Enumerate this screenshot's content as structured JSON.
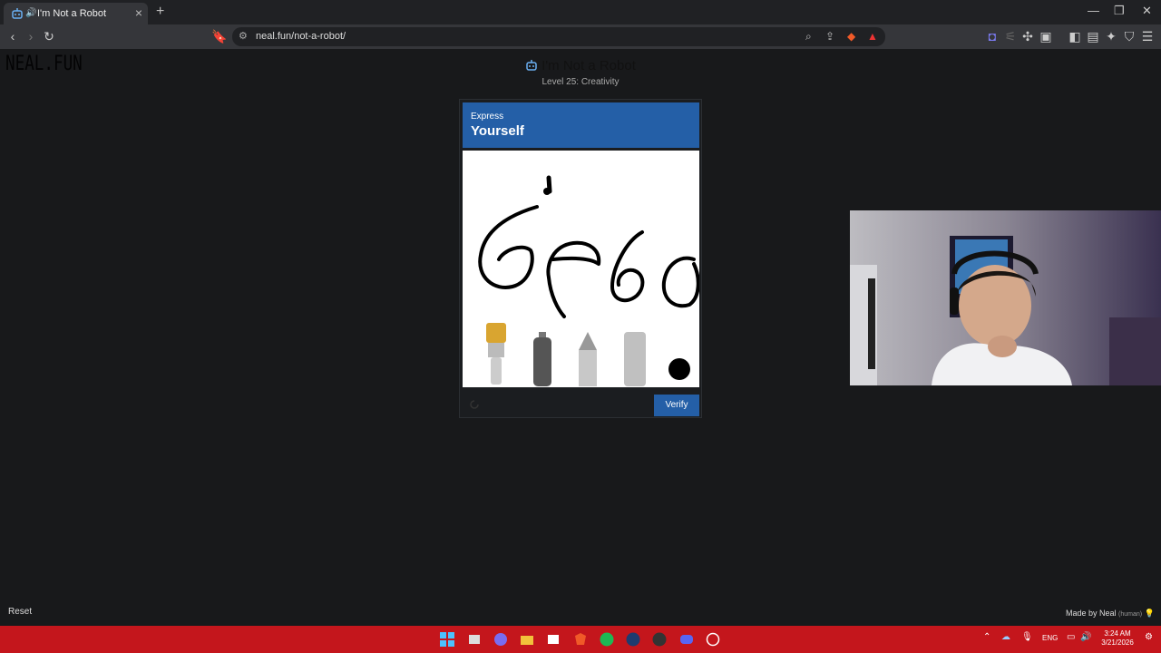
{
  "browser": {
    "tab_title": "I'm Not a Robot",
    "tab_audio_icon": "speaker-icon",
    "new_tab_label": "+",
    "url": "neal.fun/not-a-robot/",
    "window_controls": [
      "—",
      "❐",
      "✕"
    ]
  },
  "page": {
    "logo": "NEAL.FUN",
    "title": "I'm Not a Robot",
    "subtitle": "Level 25: Creativity",
    "reset_label": "Reset",
    "made_by": "Made by Neal",
    "made_by_note": "(human)"
  },
  "captcha": {
    "header_small": "Express",
    "header_big": "Yourself",
    "verify_label": "Verify",
    "tools": [
      "paintbrush",
      "spray-can",
      "pencil",
      "eraser",
      "color-swatch"
    ],
    "selected_color": "#000000",
    "accent_color": "#245fa7"
  },
  "taskbar": {
    "language": "ENG",
    "time": "3:24 AM",
    "date": "3/21/2026",
    "color": "#c4161c"
  }
}
